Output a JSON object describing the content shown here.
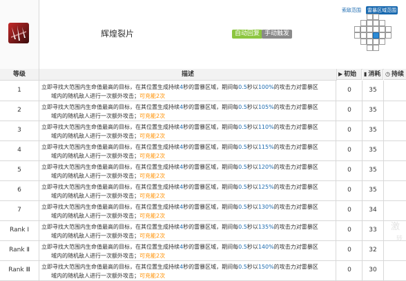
{
  "skill": {
    "name": "辉煌裂片",
    "tag_auto": "自动回复",
    "tag_manual": "手动触发",
    "icon": "skill-shard-icon"
  },
  "range_panel": {
    "tab_attack": "索敌范围",
    "tab_storm": "雷暴区域范围"
  },
  "table": {
    "headers": {
      "level": "等级",
      "description": "描述",
      "initial": "初始",
      "cost": "消耗",
      "duration": "持续"
    },
    "rows": [
      {
        "level": "1",
        "d1a": "立即寻找大范围内生命值最高的目标，在其位置生成持续",
        "dur_sec": "4",
        "d1b": "秒的雷暴区域，期间每",
        "interval": "0.5",
        "d1c": "秒以",
        "pct": "100%",
        "d1d": "的攻击力对雷暴区",
        "d2": "域内的随机敌人进行一次额外攻击；",
        "charges": "可充能2次",
        "initial": "0",
        "cost": "35"
      },
      {
        "level": "2",
        "d1a": "立即寻找大范围内生命值最高的目标，在其位置生成持续",
        "dur_sec": "4",
        "d1b": "秒的雷暴区域，期间每",
        "interval": "0.5",
        "d1c": "秒以",
        "pct": "105%",
        "d1d": "的攻击力对雷暴区",
        "d2": "域内的随机敌人进行一次额外攻击；",
        "charges": "可充能2次",
        "initial": "0",
        "cost": "35"
      },
      {
        "level": "3",
        "d1a": "立即寻找大范围内生命值最高的目标，在其位置生成持续",
        "dur_sec": "4",
        "d1b": "秒的雷暴区域，期间每",
        "interval": "0.5",
        "d1c": "秒以",
        "pct": "110%",
        "d1d": "的攻击力对雷暴区",
        "d2": "域内的随机敌人进行一次额外攻击；",
        "charges": "可充能2次",
        "initial": "0",
        "cost": "35"
      },
      {
        "level": "4",
        "d1a": "立即寻找大范围内生命值最高的目标，在其位置生成持续",
        "dur_sec": "4",
        "d1b": "秒的雷暴区域，期间每",
        "interval": "0.5",
        "d1c": "秒以",
        "pct": "115%",
        "d1d": "的攻击力对雷暴区",
        "d2": "域内的随机敌人进行一次额外攻击；",
        "charges": "可充能2次",
        "initial": "0",
        "cost": "35"
      },
      {
        "level": "5",
        "d1a": "立即寻找大范围内生命值最高的目标，在其位置生成持续",
        "dur_sec": "4",
        "d1b": "秒的雷暴区域，期间每",
        "interval": "0.5",
        "d1c": "秒以",
        "pct": "120%",
        "d1d": "的攻击力对雷暴区",
        "d2": "域内的随机敌人进行一次额外攻击；",
        "charges": "可充能2次",
        "initial": "0",
        "cost": "35"
      },
      {
        "level": "6",
        "d1a": "立即寻找大范围内生命值最高的目标，在其位置生成持续",
        "dur_sec": "4",
        "d1b": "秒的雷暴区域，期间每",
        "interval": "0.5",
        "d1c": "秒以",
        "pct": "125%",
        "d1d": "的攻击力对雷暴区",
        "d2": "域内的随机敌人进行一次额外攻击；",
        "charges": "可充能2次",
        "initial": "0",
        "cost": "35"
      },
      {
        "level": "7",
        "d1a": "立即寻找大范围内生命值最高的目标，在其位置生成持续",
        "dur_sec": "4",
        "d1b": "秒的雷暴区域，期间每",
        "interval": "0.5",
        "d1c": "秒以",
        "pct": "130%",
        "d1d": "的攻击力对雷暴区",
        "d2": "域内的随机敌人进行一次额外攻击；",
        "charges": "可充能2次",
        "initial": "0",
        "cost": "34"
      },
      {
        "level": "Rank Ⅰ",
        "d1a": "立即寻找大范围内生命值最高的目标，在其位置生成持续",
        "dur_sec": "4",
        "d1b": "秒的雷暴区域，期间每",
        "interval": "0.5",
        "d1c": "秒以",
        "pct": "135%",
        "d1d": "的攻击力对雷暴区",
        "d2": "域内的随机敌人进行一次额外攻击；",
        "charges": "可充能2次",
        "initial": "0",
        "cost": "33"
      },
      {
        "level": "Rank Ⅱ",
        "d1a": "立即寻找大范围内生命值最高的目标，在其位置生成持续",
        "dur_sec": "4",
        "d1b": "秒的雷暴区域，期间每",
        "interval": "0.5",
        "d1c": "秒以",
        "pct": "140%",
        "d1d": "的攻击力对雷暴区",
        "d2": "域内的随机敌人进行一次额外攻击；",
        "charges": "可充能2次",
        "initial": "0",
        "cost": "32"
      },
      {
        "level": "Rank Ⅲ",
        "d1a": "立即寻找大范围内生命值最高的目标，在其位置生成持续",
        "dur_sec": "4",
        "d1b": "秒的雷暴区域，期间每",
        "interval": "0.5",
        "d1c": "秒以",
        "pct": "150%",
        "d1d": "的攻击力对雷暴区",
        "d2": "域内的随机敌人进行一次额外攻击；",
        "charges": "可充能2次",
        "initial": "0",
        "cost": "30"
      }
    ]
  },
  "watermark": {
    "line1": "激",
    "line2": "转"
  },
  "colors": {
    "blue": "#1a6ab0",
    "orange": "#ff9000",
    "green": "#8cc63f",
    "gray": "#8a8a8a"
  }
}
